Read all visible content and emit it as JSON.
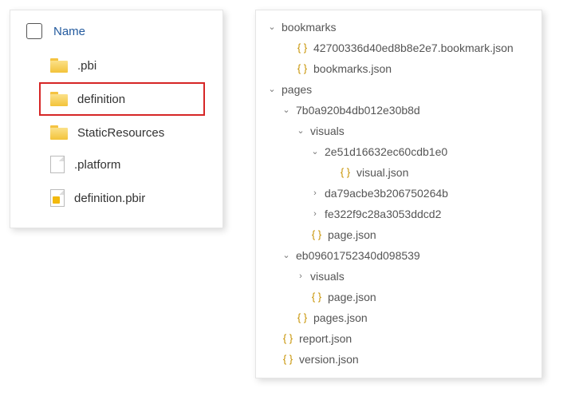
{
  "file_list": {
    "header": "Name",
    "items": [
      {
        "name": ".pbi",
        "kind": "folder",
        "highlight": false
      },
      {
        "name": "definition",
        "kind": "folder",
        "highlight": true
      },
      {
        "name": "StaticResources",
        "kind": "folder",
        "highlight": false
      },
      {
        "name": ".platform",
        "kind": "file",
        "highlight": false
      },
      {
        "name": "definition.pbir",
        "kind": "pbir",
        "highlight": false
      }
    ]
  },
  "tree": [
    {
      "depth": 0,
      "chev": "down",
      "icon": "",
      "label": "bookmarks"
    },
    {
      "depth": 1,
      "chev": "",
      "icon": "json",
      "label": "42700336d40ed8b8e2e7.bookmark.json"
    },
    {
      "depth": 1,
      "chev": "",
      "icon": "json",
      "label": "bookmarks.json"
    },
    {
      "depth": 0,
      "chev": "down",
      "icon": "",
      "label": "pages"
    },
    {
      "depth": 1,
      "chev": "down",
      "icon": "",
      "label": "7b0a920b4db012e30b8d"
    },
    {
      "depth": 2,
      "chev": "down",
      "icon": "",
      "label": "visuals"
    },
    {
      "depth": 3,
      "chev": "down",
      "icon": "",
      "label": "2e51d16632ec60cdb1e0"
    },
    {
      "depth": 4,
      "chev": "",
      "icon": "json",
      "label": "visual.json"
    },
    {
      "depth": 3,
      "chev": "right",
      "icon": "",
      "label": "da79acbe3b206750264b"
    },
    {
      "depth": 3,
      "chev": "right",
      "icon": "",
      "label": "fe322f9c28a3053ddcd2"
    },
    {
      "depth": 2,
      "chev": "",
      "icon": "json",
      "label": "page.json"
    },
    {
      "depth": 1,
      "chev": "down",
      "icon": "",
      "label": "eb09601752340d098539"
    },
    {
      "depth": 2,
      "chev": "right",
      "icon": "",
      "label": "visuals"
    },
    {
      "depth": 2,
      "chev": "",
      "icon": "json",
      "label": "page.json"
    },
    {
      "depth": 1,
      "chev": "",
      "icon": "json",
      "label": "pages.json"
    },
    {
      "depth": 0,
      "chev": "",
      "icon": "json",
      "label": "report.json"
    },
    {
      "depth": 0,
      "chev": "",
      "icon": "json",
      "label": "version.json"
    }
  ]
}
